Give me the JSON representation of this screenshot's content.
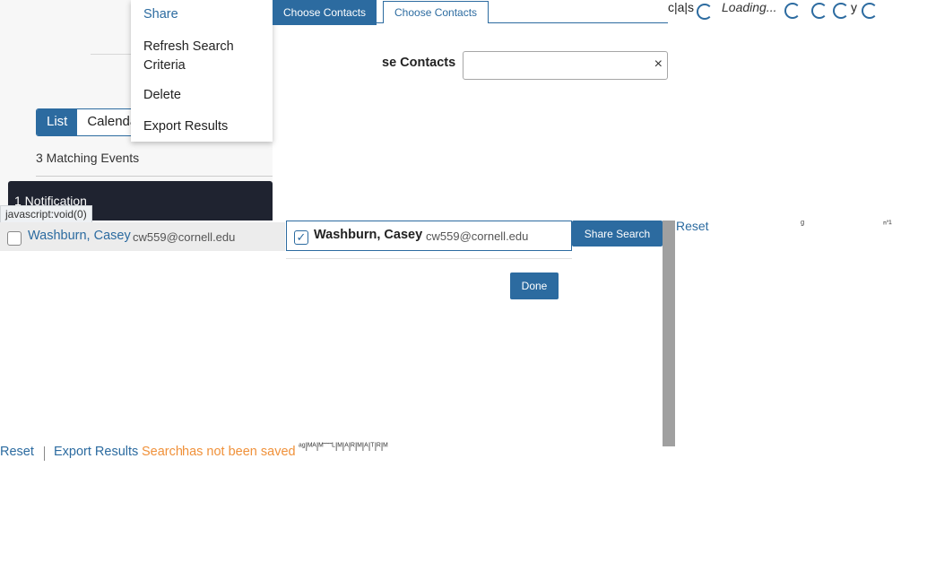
{
  "menu": {
    "items": [
      "Share",
      "Refresh Search Criteria",
      "Delete",
      "Export Results"
    ]
  },
  "tabs": [
    "Choose Contacts",
    "Choose Contacts"
  ],
  "header_fragments": {
    "left": "c|a|s",
    "loading": "Loading...",
    "right": "y"
  },
  "contacts_field": {
    "label": "se Contacts",
    "value": "",
    "clear": "×"
  },
  "view_toggle": {
    "list": "List",
    "calendar": "Calenda"
  },
  "results": {
    "count_text": "3 Matching Events"
  },
  "notification": {
    "text": "1 Notification"
  },
  "status_tip": "javascript:void(0)",
  "contact_row": {
    "name": "Washburn, Casey",
    "email": "cw559@cornell.edu"
  },
  "selected_contact": {
    "name": "Washburn, Casey",
    "email": "cw559@cornell.edu",
    "check": "✓"
  },
  "buttons": {
    "share_search": "Share Search",
    "done": "Done"
  },
  "right_links": {
    "reset": "Reset"
  },
  "bottom_bar": {
    "reset": "Reset",
    "export": "Export Results",
    "search": "Search",
    "not_saved": "has not been saved"
  },
  "colors": {
    "accent": "#2c6ba0",
    "warning": "#f0913a",
    "dark_bar": "#1f2330"
  }
}
